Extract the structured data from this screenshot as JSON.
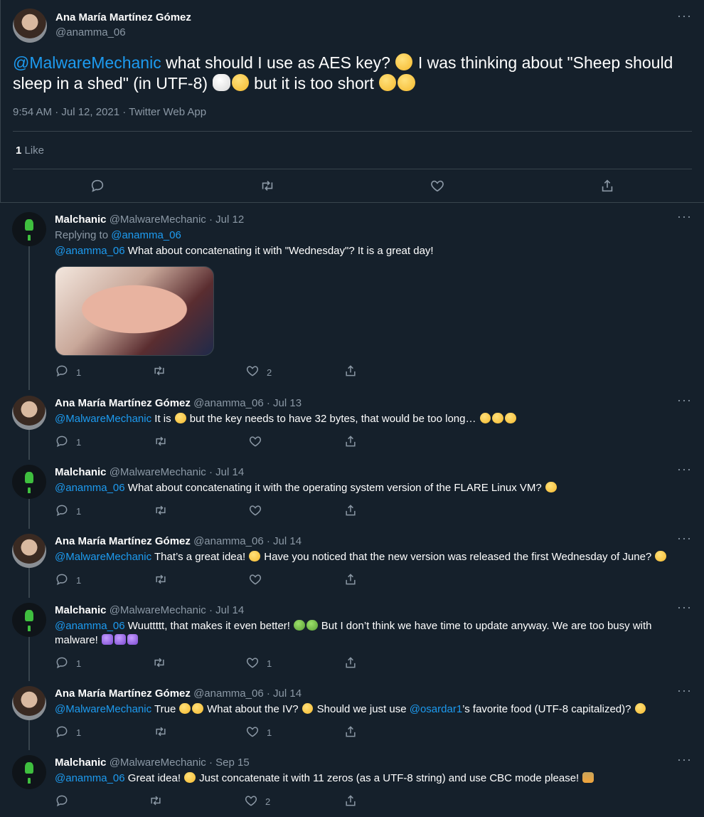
{
  "main_tweet": {
    "author_name": "Ana María Martínez Gómez",
    "author_handle": "@anamma_06",
    "mention": "@MalwareMechanic",
    "text_1": " what should I use as AES key? ",
    "text_2": " I was thinking about \"Sheep should sleep in a shed\" (in UTF-8) ",
    "text_3": " but it is too short ",
    "timestamp": "9:54 AM · Jul 12, 2021 · Twitter Web App",
    "likes_count": "1",
    "likes_label": " Like"
  },
  "replies": [
    {
      "name": "Malchanic",
      "handle_date": "@MalwareMechanic · Jul 12",
      "replying_to_label": "Replying to ",
      "replying_to_handle": "@anamma_06",
      "mention": "@anamma_06",
      "text": " What about concatenating it with \"Wednesday\"? It is a great day!",
      "reply_count": "1",
      "like_count": "2"
    },
    {
      "name": "Ana María Martínez Gómez",
      "handle_date": "@anamma_06 · Jul 13",
      "mention": "@MalwareMechanic",
      "text_1": " It is ",
      "text_2": " but the key needs to have 32 bytes, that would be too long… ",
      "reply_count": "1",
      "like_count": ""
    },
    {
      "name": "Malchanic",
      "handle_date": "@MalwareMechanic · Jul 14",
      "mention": "@anamma_06",
      "text": " What about concatenating it with the operating system version of the FLARE Linux VM? ",
      "reply_count": "1",
      "like_count": ""
    },
    {
      "name": "Ana María Martínez Gómez",
      "handle_date": "@anamma_06 · Jul 14",
      "mention": "@MalwareMechanic",
      "text_1": " That’s a great idea! ",
      "text_2": " Have you noticed that the new version was released the first Wednesday of June? ",
      "reply_count": "1",
      "like_count": ""
    },
    {
      "name": "Malchanic",
      "handle_date": "@MalwareMechanic · Jul 14",
      "mention": "@anamma_06",
      "text_1": " Wuuttttt, that makes it even better! ",
      "text_2": " But I don’t think we have time to update anyway. We are too busy with malware! ",
      "reply_count": "1",
      "like_count": "1"
    },
    {
      "name": "Ana María Martínez Gómez",
      "handle_date": "@anamma_06 · Jul 14",
      "mention": "@MalwareMechanic",
      "text_1": " True ",
      "text_2": " What about the IV? ",
      "text_3": " Should we just use ",
      "mention_2": "@osardar1",
      "text_4": "’s favorite food (UTF-8 capitalized)? ",
      "reply_count": "1",
      "like_count": "1"
    },
    {
      "name": "Malchanic",
      "handle_date": "@MalwareMechanic · Sep 15",
      "mention": "@anamma_06",
      "text_1": " Great idea! ",
      "text_2": " Just concatenate it with 11 zeros (as a UTF-8 string) and use CBC mode please! ",
      "reply_count": "",
      "like_count": "2"
    }
  ],
  "icons": {
    "reply": "reply-icon",
    "retweet": "retweet-icon",
    "like": "heart-icon",
    "share": "share-icon",
    "more": "more-icon"
  },
  "colors": {
    "background": "#15202b",
    "link": "#1d9bf0",
    "muted": "#8b98a5",
    "divider": "#38444d"
  }
}
